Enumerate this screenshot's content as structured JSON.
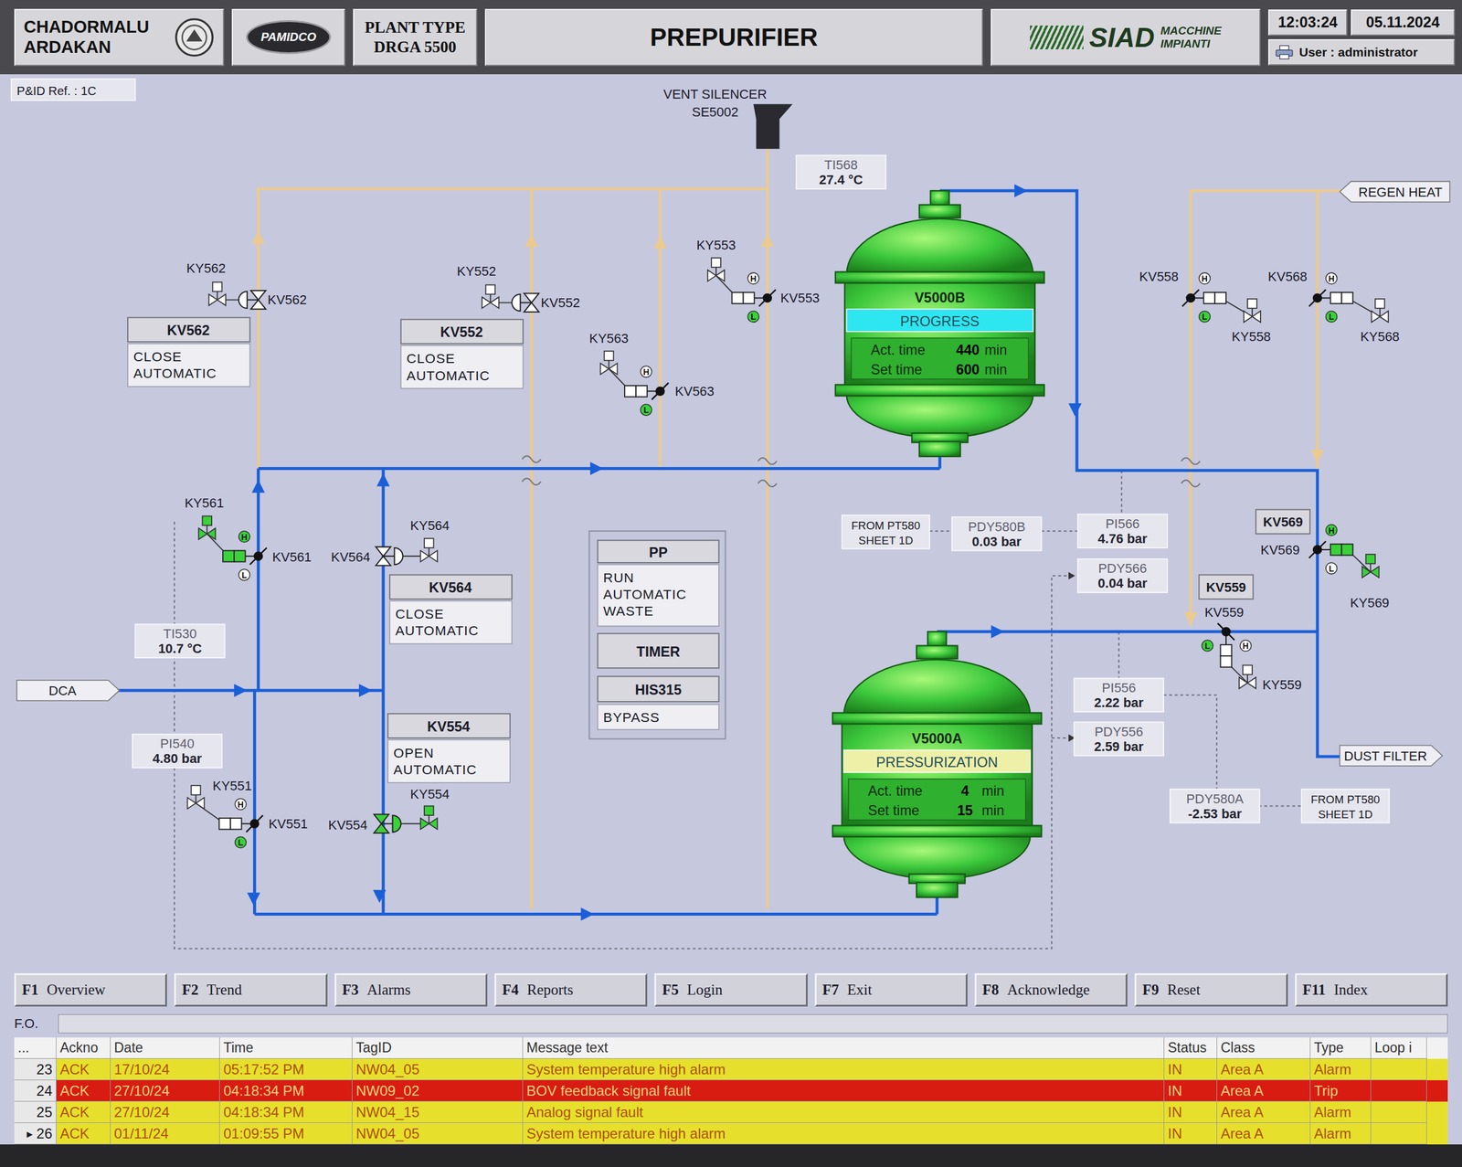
{
  "header": {
    "site": [
      "CHADORMALU",
      "ARDAKAN"
    ],
    "contractor_logo": "PAMIDCO",
    "plant_type": [
      "PLANT TYPE",
      "DRGA 5500"
    ],
    "title": "PREPURIFIER",
    "vendor_logo": {
      "name": "SIAD",
      "sub": [
        "MACCHINE",
        "IMPIANTI"
      ]
    },
    "time": "12:03:24",
    "date": "05.11.2024",
    "user": "User : administrator"
  },
  "diagram": {
    "pid_ref": "P&ID Ref. : 1C",
    "vent": [
      "VENT SILENCER",
      "SE5002"
    ],
    "pipe_tags": [
      {
        "text": "DCA",
        "direction": "right"
      },
      {
        "text": "REGEN HEAT",
        "direction": "left"
      },
      {
        "text": "DUST FILTER",
        "direction": "right"
      }
    ],
    "instruments": [
      {
        "tag": "TI568",
        "value": "27.4 °C"
      },
      {
        "tag": "TI530",
        "value": "10.7 °C"
      },
      {
        "tag": "PI540",
        "value": "4.80 bar"
      },
      {
        "tag": "PDY580B",
        "value": "0.03 bar"
      },
      {
        "tag": "PI566",
        "value": "4.76 bar"
      },
      {
        "tag": "PDY566",
        "value": "0.04 bar"
      },
      {
        "tag": "PI556",
        "value": "2.22 bar"
      },
      {
        "tag": "PDY556",
        "value": "2.59 bar"
      },
      {
        "tag": "PDY580A",
        "value": "-2.53 bar"
      }
    ],
    "signal_refs": [
      [
        "FROM PT580",
        "SHEET 1D"
      ],
      [
        "FROM PT580",
        "SHEET 1D"
      ]
    ],
    "limit_labels": {
      "high": "H",
      "low": "L"
    },
    "valves": [
      {
        "tag": "KV562",
        "solenoid": "KY562",
        "kind": "gate",
        "open": false
      },
      {
        "tag": "KV552",
        "solenoid": "KY552",
        "kind": "gate",
        "open": false
      },
      {
        "tag": "KV553",
        "solenoid": "KY553",
        "kind": "butterfly",
        "open": false
      },
      {
        "tag": "KV563",
        "solenoid": "KY563",
        "kind": "butterfly",
        "open": false
      },
      {
        "tag": "KV558",
        "solenoid": "KY558",
        "kind": "butterfly",
        "open": false
      },
      {
        "tag": "KV568",
        "solenoid": "KY568",
        "kind": "butterfly",
        "open": false
      },
      {
        "tag": "KV561",
        "solenoid": "KY561",
        "kind": "butterfly",
        "open": true
      },
      {
        "tag": "KV564",
        "solenoid": "KY564",
        "kind": "gate",
        "open": false
      },
      {
        "tag": "KV551",
        "solenoid": "KY551",
        "kind": "butterfly",
        "open": false
      },
      {
        "tag": "KV554",
        "solenoid": "KY554",
        "kind": "gate",
        "open": true
      },
      {
        "tag": "KV569",
        "solenoid": "KY569",
        "kind": "butterfly",
        "open": true
      },
      {
        "tag": "KV559",
        "solenoid": "KY559",
        "kind": "butterfly",
        "open": false
      }
    ],
    "valve_tag_boxes": [
      "KV569",
      "KV559"
    ],
    "valve_panels": [
      {
        "tag": "KV562",
        "lines": [
          "CLOSE",
          "AUTOMATIC"
        ]
      },
      {
        "tag": "KV552",
        "lines": [
          "CLOSE",
          "AUTOMATIC"
        ]
      },
      {
        "tag": "KV564",
        "lines": [
          "CLOSE",
          "AUTOMATIC"
        ]
      },
      {
        "tag": "KV554",
        "lines": [
          "OPEN",
          "AUTOMATIC"
        ]
      }
    ],
    "sequence_panel": [
      {
        "kind": "header",
        "lines": [
          "PP"
        ]
      },
      {
        "kind": "body",
        "lines": [
          "RUN",
          "AUTOMATIC",
          "WASTE"
        ]
      },
      {
        "kind": "button",
        "lines": [
          "TIMER"
        ]
      },
      {
        "kind": "header",
        "lines": [
          "HIS315"
        ]
      },
      {
        "kind": "body",
        "lines": [
          "BYPASS"
        ]
      }
    ],
    "vessels": [
      {
        "name": "V5000B",
        "step": "PROGRESS",
        "color": "#2ee6f0",
        "act_label": "Act. time",
        "act": "440",
        "set_label": "Set time",
        "set": "600",
        "unit": "min"
      },
      {
        "name": "V5000A",
        "step": "PRESSURIZATION",
        "color": "#eef0a8",
        "act_label": "Act. time",
        "act": "4",
        "set_label": "Set time",
        "set": "15",
        "unit": "min"
      }
    ]
  },
  "function_keys": [
    {
      "key": "F1",
      "label": "Overview"
    },
    {
      "key": "F2",
      "label": "Trend"
    },
    {
      "key": "F3",
      "label": "Alarms"
    },
    {
      "key": "F4",
      "label": "Reports"
    },
    {
      "key": "F5",
      "label": "Login"
    },
    {
      "key": "F7",
      "label": "Exit"
    },
    {
      "key": "F8",
      "label": "Acknowledge"
    },
    {
      "key": "F9",
      "label": "Reset"
    },
    {
      "key": "F11",
      "label": "Index"
    }
  ],
  "fo_label": "F.O.",
  "alarm_table": {
    "columns": [
      "...",
      "Ackno",
      "Date",
      "Time",
      "TagID",
      "Message text",
      "Status",
      "Class",
      "Type",
      "Loop i"
    ],
    "current_row_marker": "▸",
    "rows": [
      {
        "index": "23",
        "ack": "ACK",
        "date": "17/10/24",
        "time": "05:17:52 PM",
        "tag": "NW04_05",
        "message": "System temperature high alarm",
        "status": "IN",
        "class": "Area A",
        "type": "Alarm",
        "color": "#e6e02c",
        "selected": false
      },
      {
        "index": "24",
        "ack": "ACK",
        "date": "27/10/24",
        "time": "04:18:34 PM",
        "tag": "NW09_02",
        "message": "BOV feedback signal fault",
        "status": "IN",
        "class": "Area A",
        "type": "Trip",
        "color": "#d81c12",
        "selected": false
      },
      {
        "index": "25",
        "ack": "ACK",
        "date": "27/10/24",
        "time": "04:18:34 PM",
        "tag": "NW04_15",
        "message": "Analog signal fault",
        "status": "IN",
        "class": "Area A",
        "type": "Alarm",
        "color": "#e6e02c",
        "selected": false
      },
      {
        "index": "26",
        "ack": "ACK",
        "date": "01/11/24",
        "time": "01:09:55 PM",
        "tag": "NW04_05",
        "message": "System temperature high alarm",
        "status": "IN",
        "class": "Area A",
        "type": "Alarm",
        "color": "#e6e02c",
        "selected": true
      }
    ]
  }
}
